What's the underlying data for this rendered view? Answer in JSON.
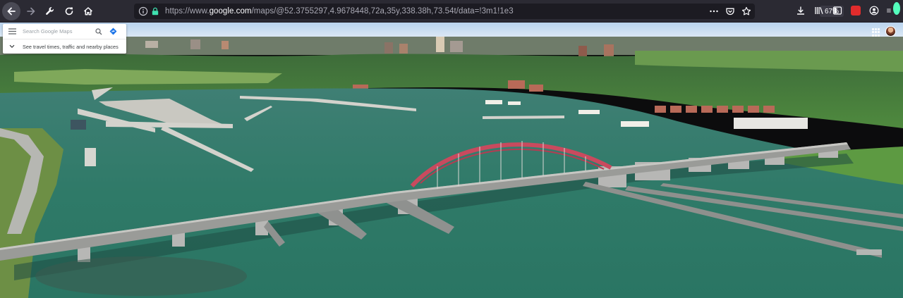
{
  "browser": {
    "url_prefix": "https://www.",
    "url_host": "google.com",
    "url_path": "/maps/@52.3755297,4.9678448,72a,35y,338.38h,73.54t/data=!3m1!1e3",
    "zoom": "67%"
  },
  "icons": {
    "back": "back-arrow-icon",
    "forward": "forward-arrow-icon",
    "tools": "wrench-icon",
    "reload": "reload-icon",
    "home": "home-icon",
    "info": "info-icon",
    "lock": "lock-icon",
    "more": "more-dots-icon",
    "pocket": "pocket-icon",
    "bookmark": "star-icon",
    "download": "download-icon",
    "library": "library-icon",
    "sidebar": "sidebar-icon",
    "extension": "extension-icon",
    "account": "account-icon",
    "menu": "hamburger-menu-icon"
  },
  "colors": {
    "toolbar": "#2b2a33",
    "urlbar": "#1c1b22",
    "water": "#2f7a68",
    "bridge_arch": "#c94a5e",
    "extension": "#e12c2c"
  },
  "maps": {
    "search_placeholder": "Search Google Maps",
    "travel_text": "See travel times, traffic and nearby places"
  }
}
